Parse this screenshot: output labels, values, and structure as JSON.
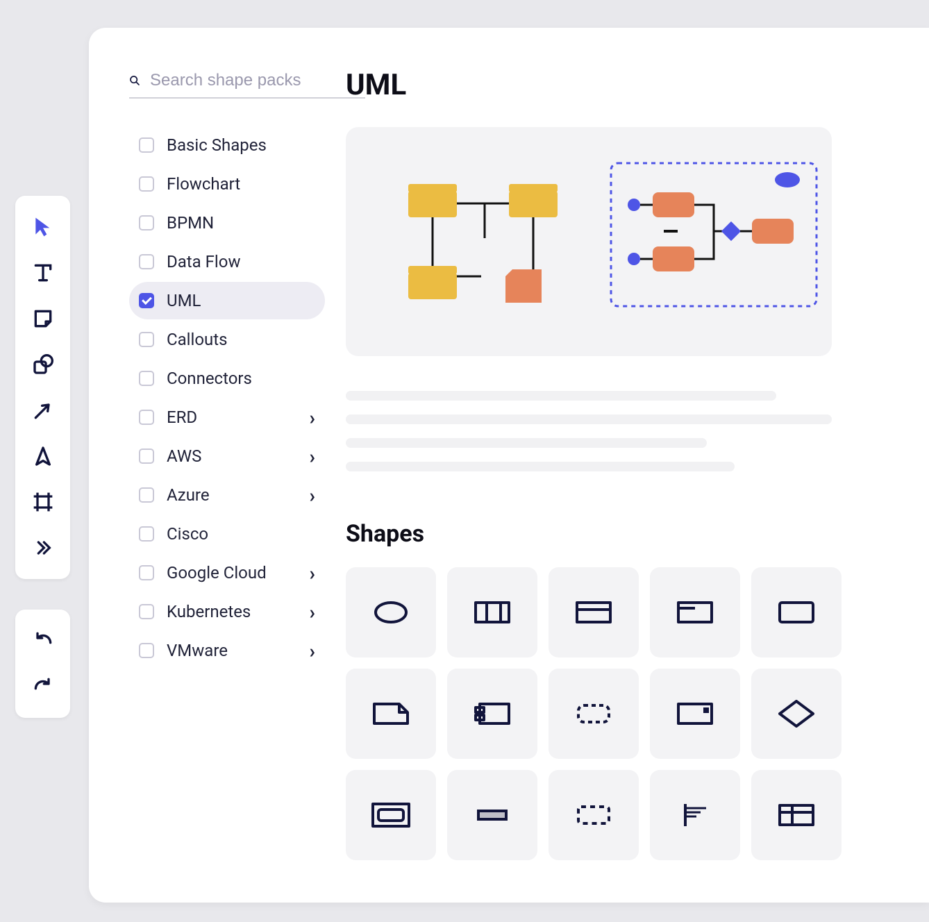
{
  "toolbar": {
    "tools": [
      {
        "name": "pointer-tool",
        "icon": "pointer"
      },
      {
        "name": "text-tool",
        "icon": "text"
      },
      {
        "name": "sticky-note-tool",
        "icon": "note"
      },
      {
        "name": "shape-tool",
        "icon": "shape"
      },
      {
        "name": "arrow-tool",
        "icon": "arrow"
      },
      {
        "name": "pen-tool",
        "icon": "pen"
      },
      {
        "name": "frame-tool",
        "icon": "frame"
      },
      {
        "name": "more-tool",
        "icon": "more"
      }
    ],
    "history": [
      {
        "name": "undo-button",
        "icon": "undo"
      },
      {
        "name": "redo-button",
        "icon": "redo"
      }
    ]
  },
  "search": {
    "placeholder": "Search shape packs"
  },
  "packs": [
    {
      "label": "Basic Shapes",
      "checked": false,
      "expandable": false
    },
    {
      "label": "Flowchart",
      "checked": false,
      "expandable": false
    },
    {
      "label": "BPMN",
      "checked": false,
      "expandable": false
    },
    {
      "label": "Data Flow",
      "checked": false,
      "expandable": false
    },
    {
      "label": "UML",
      "checked": true,
      "expandable": false,
      "selected": true
    },
    {
      "label": "Callouts",
      "checked": false,
      "expandable": false
    },
    {
      "label": "Connectors",
      "checked": false,
      "expandable": false
    },
    {
      "label": "ERD",
      "checked": false,
      "expandable": true
    },
    {
      "label": "AWS",
      "checked": false,
      "expandable": true
    },
    {
      "label": "Azure",
      "checked": false,
      "expandable": true
    },
    {
      "label": "Cisco",
      "checked": false,
      "expandable": false
    },
    {
      "label": "Google Cloud",
      "checked": false,
      "expandable": true
    },
    {
      "label": "Kubernetes",
      "checked": false,
      "expandable": true
    },
    {
      "label": "VMware",
      "checked": false,
      "expandable": true
    }
  ],
  "detail": {
    "title": "UML",
    "shapes_heading": "Shapes"
  },
  "colors": {
    "accent": "#4e55e6",
    "ink": "#11143b",
    "folder": "#ebbc42",
    "orange": "#e6845a",
    "blue": "#4e55e6"
  },
  "shapes": [
    {
      "name": "uml-use-case",
      "icon": "ellipse"
    },
    {
      "name": "uml-class-3col",
      "icon": "cols3"
    },
    {
      "name": "uml-class-header",
      "icon": "headerbox"
    },
    {
      "name": "uml-titlebar",
      "icon": "titlebar"
    },
    {
      "name": "uml-object",
      "icon": "rect"
    },
    {
      "name": "uml-note",
      "icon": "note"
    },
    {
      "name": "uml-component",
      "icon": "component"
    },
    {
      "name": "uml-boundary-dashed",
      "icon": "dashed"
    },
    {
      "name": "uml-port-box",
      "icon": "portbox"
    },
    {
      "name": "uml-decision",
      "icon": "diamond"
    },
    {
      "name": "uml-state",
      "icon": "innerbox"
    },
    {
      "name": "uml-bar",
      "icon": "barbox"
    },
    {
      "name": "uml-region",
      "icon": "dashed2"
    },
    {
      "name": "uml-partition",
      "icon": "bracket"
    },
    {
      "name": "uml-table",
      "icon": "table"
    }
  ]
}
